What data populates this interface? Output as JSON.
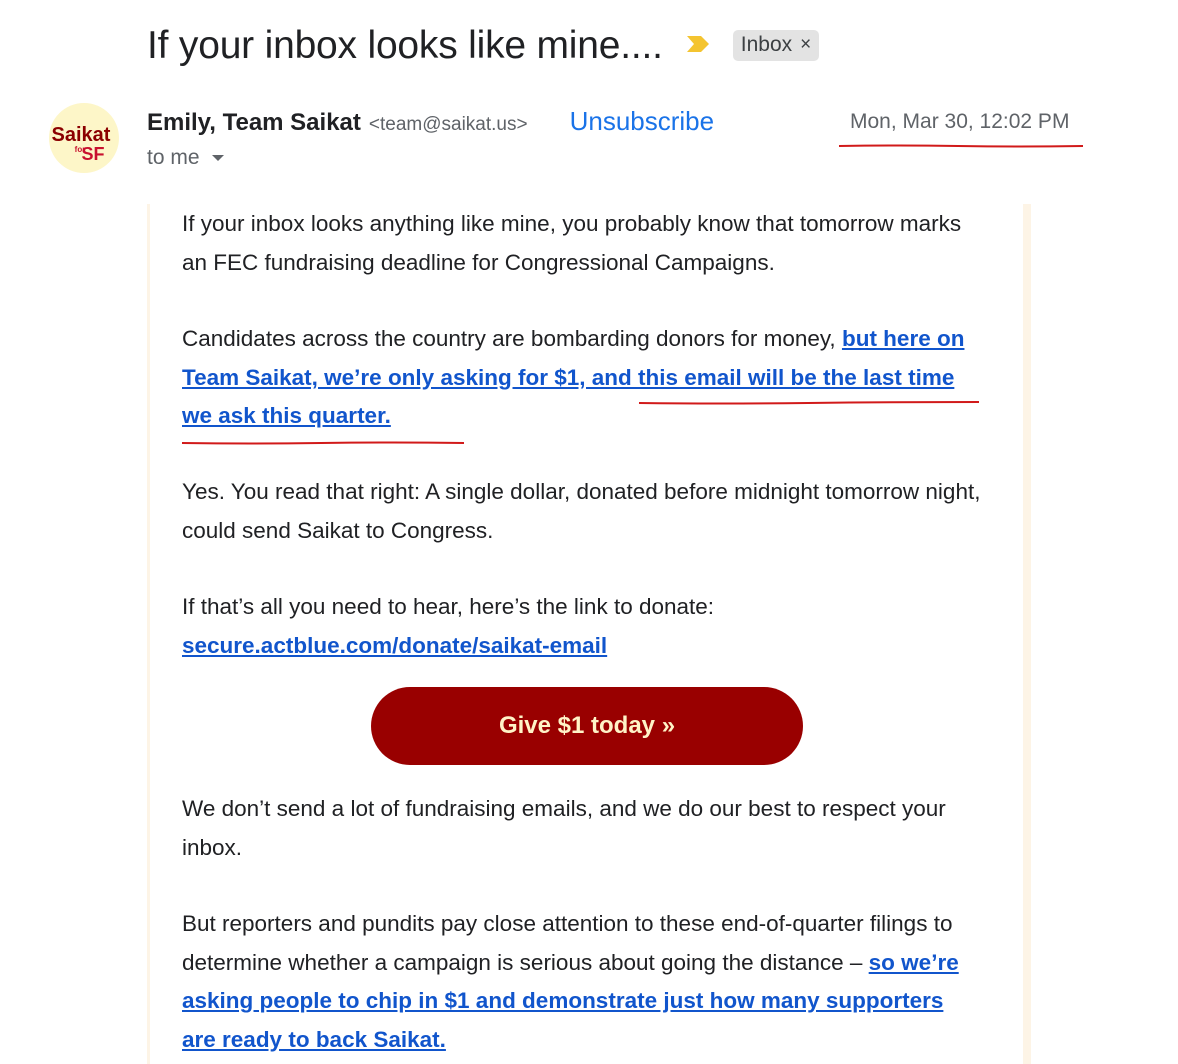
{
  "subject": {
    "title": "If your inbox looks like mine....",
    "label_chip": "Inbox",
    "label_remove": "×"
  },
  "sender": {
    "avatar_text_line1": "Saikat",
    "avatar_text_for": "for",
    "avatar_text_sf": "SF",
    "name": "Emily, Team Saikat",
    "email": "<team@saikat.us>",
    "unsubscribe": "Unsubscribe",
    "date": "Mon, Mar 30, 12:02 PM",
    "recipient": "to me"
  },
  "body": {
    "p1": "If your inbox looks anything like mine, you probably know that tomorrow marks an FEC fundraising deadline for Congressional Campaigns.",
    "p2_text": "Candidates across the country are bombarding donors for money, ",
    "p2_link": "but here on Team Saikat, we’re only asking for $1, and this email will be the last time we ask this quarter.",
    "p3": "Yes. You read that right: A single dollar, donated before midnight tomorrow night, could send Saikat to Congress.",
    "p4_text": "If that’s all you need to hear, here’s the link to donate:",
    "p4_link": "secure.actblue.com/donate/saikat-email",
    "button": "Give $1 today »",
    "p5": "We don’t send a lot of fundraising emails, and we do our best to respect your inbox.",
    "p6_text": "But reporters and pundits pay close attention to these end-of-quarter filings to determine whether a campaign is serious about going the distance – ",
    "p6_link": "so we’re asking people to chip in $1 and demonstrate just how many supporters are ready to back Saikat."
  },
  "colors": {
    "link": "#1155cc",
    "unsubscribe": "#1a73e8",
    "button_bg": "#990000",
    "button_text": "#fff3c7",
    "annotation_red": "#d11a1a",
    "importance_marker": "#f4c430"
  }
}
